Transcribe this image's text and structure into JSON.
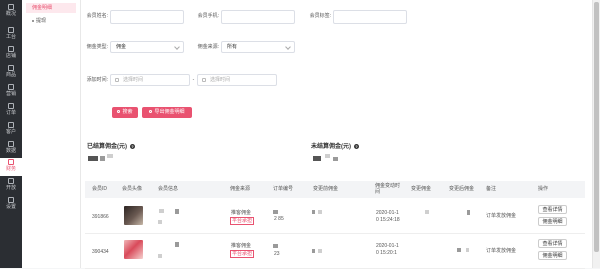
{
  "sidebar": {
    "items": [
      {
        "label": "概况",
        "icon": "home-icon"
      },
      {
        "label": "工台",
        "icon": "workbench-icon"
      },
      {
        "label": "店铺",
        "icon": "store-icon"
      },
      {
        "label": "商品",
        "icon": "goods-icon"
      },
      {
        "label": "营销",
        "icon": "marketing-icon"
      },
      {
        "label": "订单",
        "icon": "order-icon"
      },
      {
        "label": "客户",
        "icon": "customer-icon"
      },
      {
        "label": "数据",
        "icon": "data-icon"
      },
      {
        "label": "财务",
        "icon": "finance-icon",
        "active": true
      },
      {
        "label": "开放",
        "icon": "open-icon"
      },
      {
        "label": "设置",
        "icon": "settings-icon"
      }
    ]
  },
  "subnav": {
    "active": "佣金明细",
    "item": "提现"
  },
  "filters": {
    "member_name_label": "会员姓名:",
    "member_phone_label": "会员手机:",
    "member_tag_label": "会员标签:",
    "commission_type_label": "佣金类型:",
    "commission_type_value": "佣金",
    "commission_source_label": "佣金来源:",
    "commission_source_value": "所有",
    "add_time_label": "添加时间:",
    "start_placeholder": "选择时间",
    "end_placeholder": "选择时间",
    "range_sep": "-"
  },
  "actions": {
    "search": "搜索",
    "export": "导出佣金明细"
  },
  "stats": {
    "settled_label": "已结算佣金(元)",
    "unsettled_label": "未结算佣金(元)",
    "help": "?"
  },
  "table": {
    "headers": [
      "会员ID",
      "会员头像",
      "会员信息",
      "佣金来源",
      "订单编号",
      "变更前佣金",
      "佣金变动时间",
      "变更佣金",
      "变更后佣金",
      "备注",
      "操作"
    ],
    "rows": [
      {
        "id": "391866",
        "source": "推客佣金",
        "source_tag": "平台承担",
        "order_no_a": "2",
        "order_no_b": "85",
        "time_a": "2020-01-1",
        "time_b": "0 15:24:18",
        "remark": "订单发放佣金",
        "btn1": "查看详情",
        "btn2": "佣金明细",
        "avatar_color": "#3a2d2b"
      },
      {
        "id": "390434",
        "source": "推客佣金",
        "source_tag": "平台承担",
        "order_no_a": "23",
        "order_no_b": "",
        "time_a": "2020-01-1",
        "time_b": "0 15:20:1",
        "remark": "订单发放佣金",
        "btn1": "查看详情",
        "btn2": "佣金明细",
        "avatar_color": "#d94a5a"
      }
    ]
  },
  "colors": {
    "accent": "#e95270",
    "sidebar": "#2b2e33"
  }
}
